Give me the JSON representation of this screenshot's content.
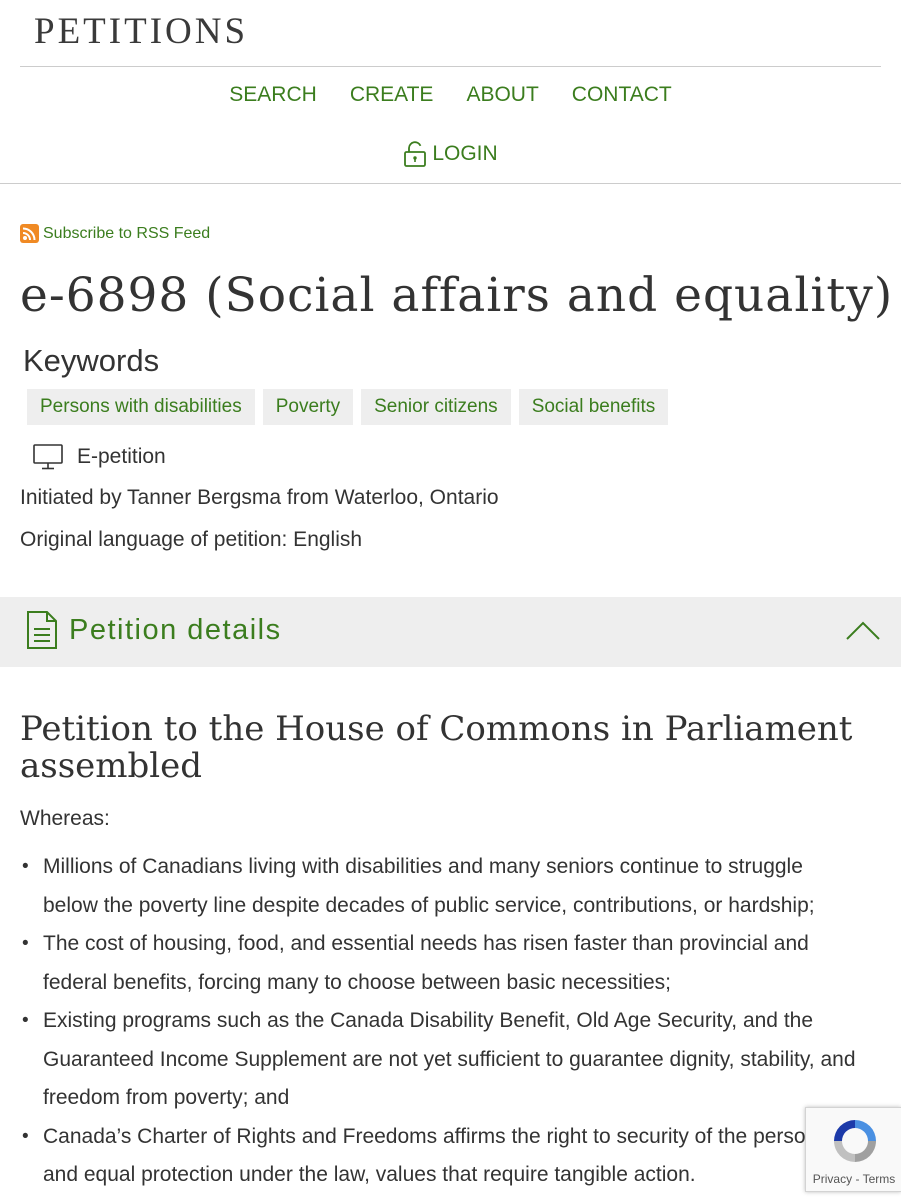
{
  "header": {
    "site_title": "PETITIONS",
    "nav": [
      "SEARCH",
      "CREATE",
      "ABOUT",
      "CONTACT"
    ],
    "login_label": "LOGIN"
  },
  "rss": {
    "label": "Subscribe to RSS Feed"
  },
  "petition": {
    "title": "e-6898 (Social affairs and equality)",
    "keywords_heading": "Keywords",
    "keywords": [
      "Persons with disabilities",
      "Poverty",
      "Senior citizens",
      "Social benefits"
    ],
    "type_label": "E-petition",
    "initiated_by": "Initiated by Tanner Bergsma from Waterloo, Ontario",
    "original_language": "Original language of petition: English"
  },
  "details": {
    "section_label": "Petition details",
    "heading": "Petition to the House of Commons in Parliament assembled",
    "whereas": "Whereas:",
    "clauses": [
      "Millions of Canadians living with disabilities and many seniors continue to struggle below the poverty line despite decades of public service, contributions, or hardship;",
      "The cost of housing, food, and essential needs has risen faster than provincial and federal benefits, forcing many to choose between basic necessities;",
      "Existing programs such as the Canada Disability Benefit, Old Age Security, and the Guaranteed Income Supplement are not yet sufficient to guarantee dignity, stability, and freedom from poverty; and",
      "Canada’s Charter of Rights and Freedoms affirms the right to security of the person and equal protection under the law, values that require tangible action."
    ]
  },
  "recaptcha": {
    "privacy": "Privacy",
    "separator": "-",
    "terms": "Terms"
  },
  "colors": {
    "accent_green": "#3b7d1e",
    "panel_gray": "#eeeeee",
    "text": "#333333"
  },
  "icons": [
    "lock-icon",
    "rss-icon",
    "monitor-icon",
    "document-icon",
    "chevron-up-icon",
    "recaptcha-icon"
  ]
}
